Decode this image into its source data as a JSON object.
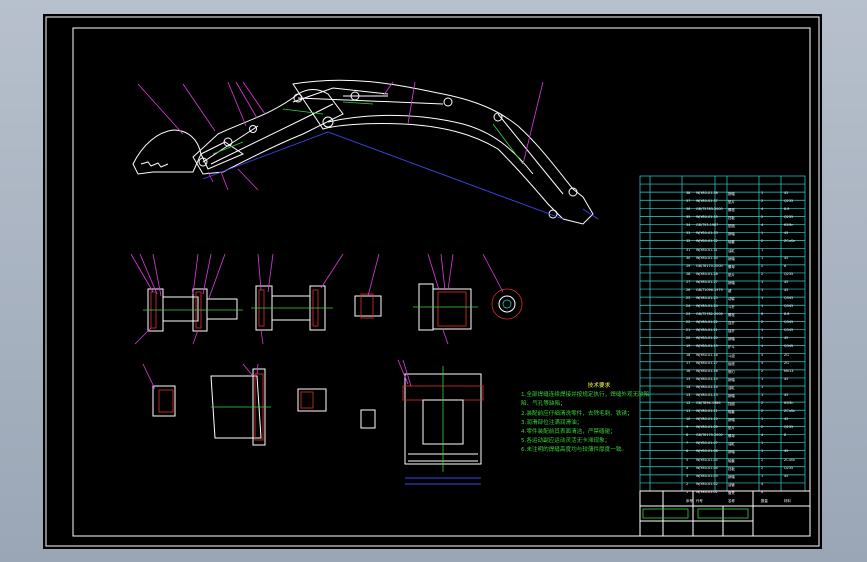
{
  "drawing": {
    "background": "#000000",
    "frame_color": "#ffffff",
    "line_colors": {
      "outline": "#ffffff",
      "hidden": "#3ad23a",
      "section": "#e0302a",
      "dimension": "#3b46e6",
      "leader": "#e03ae0",
      "table": "#2fd6d6"
    }
  },
  "notes": {
    "title": "技术要求",
    "items": [
      "1.全部焊缝连续焊接并按规定执行，焊缝外观无缺陷",
      "陷、气孔等缺陷；",
      "2.装配前应仔细清洗零件，去除毛刺、铁锈；",
      "3.润滑部位注满润滑油；",
      "4.零件装配前其表面清洁，严禁磕碰；",
      "5.各运动副应运动灵活无卡滞现象；",
      "6.未注明的焊缝高度均与较薄件厚度一致。"
    ]
  },
  "bom": {
    "rows": [
      {
        "no": "38",
        "code": "WJY80-01-38",
        "name": "销轴",
        "qty": "1",
        "mat": "45"
      },
      {
        "no": "37",
        "code": "WJY80-01-37",
        "name": "垫片",
        "qty": "2",
        "mat": "Q235"
      },
      {
        "no": "36",
        "code": "GB/T5783-2000",
        "name": "螺栓",
        "qty": "4",
        "mat": "8.8"
      },
      {
        "no": "35",
        "code": "WJY80-01-35",
        "name": "挡板",
        "qty": "2",
        "mat": "Q235"
      },
      {
        "no": "34",
        "code": "GB/T93-1987",
        "name": "垫圈",
        "qty": "4",
        "mat": "65Mn"
      },
      {
        "no": "33",
        "code": "WJY80-01-33",
        "name": "销轴",
        "qty": "1",
        "mat": "45"
      },
      {
        "no": "32",
        "code": "WJY80-01-32",
        "name": "轴套",
        "qty": "2",
        "mat": "ZCuSn"
      },
      {
        "no": "31",
        "code": "WJY80-01-31",
        "name": "油缸",
        "qty": "1",
        "mat": ""
      },
      {
        "no": "30",
        "code": "WJY80-01-30",
        "name": "销轴",
        "qty": "1",
        "mat": "45"
      },
      {
        "no": "29",
        "code": "GB/T6170-2000",
        "name": "螺母",
        "qty": "2",
        "mat": "8"
      },
      {
        "no": "28",
        "code": "WJY80-01-28",
        "name": "垫片",
        "qty": "2",
        "mat": "Q235"
      },
      {
        "no": "27",
        "code": "WJY80-01-27",
        "name": "销轴",
        "qty": "1",
        "mat": "45"
      },
      {
        "no": "26",
        "code": "GB/T1096-1979",
        "name": "键",
        "qty": "1",
        "mat": "45"
      },
      {
        "no": "25",
        "code": "WJY80-01-25",
        "name": "动臂",
        "qty": "1",
        "mat": "Q345"
      },
      {
        "no": "24",
        "code": "WJY80-01-24",
        "name": "斗杆",
        "qty": "1",
        "mat": "Q345"
      },
      {
        "no": "23",
        "code": "GB/T5782-2000",
        "name": "螺栓",
        "qty": "6",
        "mat": "8.8"
      },
      {
        "no": "22",
        "code": "WJY80-01-22",
        "name": "连杆",
        "qty": "2",
        "mat": "Q345"
      },
      {
        "no": "21",
        "code": "WJY80-01-21",
        "name": "摇杆",
        "qty": "1",
        "mat": "Q345"
      },
      {
        "no": "20",
        "code": "WJY80-01-20",
        "name": "销轴",
        "qty": "1",
        "mat": "45"
      },
      {
        "no": "19",
        "code": "WJY80-01-19",
        "name": "铲斗",
        "qty": "1",
        "mat": "Q345"
      },
      {
        "no": "18",
        "code": "WJY80-01-18",
        "name": "斗齿",
        "qty": "5",
        "mat": "ZG"
      },
      {
        "no": "17",
        "code": "WJY80-01-17",
        "name": "齿座",
        "qty": "5",
        "mat": "ZG"
      },
      {
        "no": "16",
        "code": "WJY80-01-16",
        "name": "侧刃",
        "qty": "2",
        "mat": "Mn13"
      },
      {
        "no": "15",
        "code": "WJY80-01-15",
        "name": "销轴",
        "qty": "1",
        "mat": "45"
      },
      {
        "no": "14",
        "code": "WJY80-01-14",
        "name": "油缸",
        "qty": "1",
        "mat": ""
      },
      {
        "no": "13",
        "code": "WJY80-01-13",
        "name": "销轴",
        "qty": "1",
        "mat": "45"
      },
      {
        "no": "12",
        "code": "GB/T894-1986",
        "name": "挡圈",
        "qty": "2",
        "mat": "65Mn"
      },
      {
        "no": "11",
        "code": "WJY80-01-11",
        "name": "轴套",
        "qty": "2",
        "mat": "ZCuSn"
      },
      {
        "no": "10",
        "code": "WJY80-01-10",
        "name": "销轴",
        "qty": "1",
        "mat": "45"
      },
      {
        "no": "9",
        "code": "WJY80-01-09",
        "name": "垫片",
        "qty": "2",
        "mat": "Q235"
      },
      {
        "no": "8",
        "code": "GB/T6170-2000",
        "name": "螺母",
        "qty": "4",
        "mat": "8"
      },
      {
        "no": "7",
        "code": "WJY80-01-07",
        "name": "油缸",
        "qty": "1",
        "mat": ""
      },
      {
        "no": "6",
        "code": "WJY80-01-06",
        "name": "销轴",
        "qty": "1",
        "mat": "45"
      },
      {
        "no": "5",
        "code": "WJY80-01-05",
        "name": "轴套",
        "qty": "2",
        "mat": "ZCuSn"
      },
      {
        "no": "4",
        "code": "WJY80-01-04",
        "name": "挡板",
        "qty": "2",
        "mat": "Q235"
      },
      {
        "no": "3",
        "code": "WJY80-01-03",
        "name": "销轴",
        "qty": "1",
        "mat": "45"
      },
      {
        "no": "2",
        "code": "WJY80-01-02",
        "name": "油管",
        "qty": "4",
        "mat": ""
      },
      {
        "no": "1",
        "code": "WJY80-01-01",
        "name": "管夹",
        "qty": "4",
        "mat": ""
      },
      {
        "no": "序号",
        "code": "代号",
        "name": "名称",
        "qty": "数量",
        "mat": "材料"
      }
    ]
  }
}
